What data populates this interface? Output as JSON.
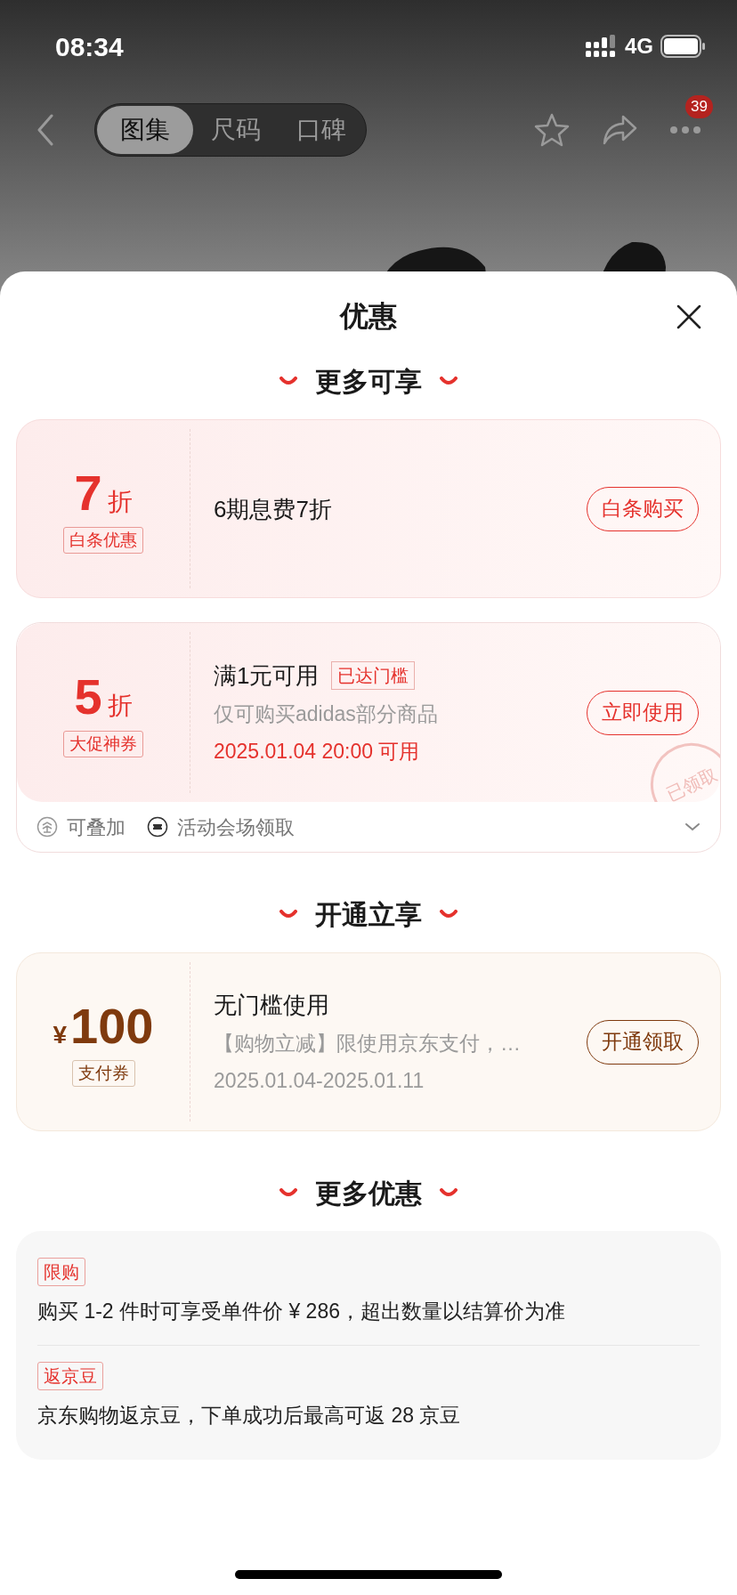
{
  "status_bar": {
    "time": "08:34",
    "network": "4G"
  },
  "nav": {
    "tabs": [
      {
        "label": "图集",
        "selected": true
      },
      {
        "label": "尺码",
        "selected": false
      },
      {
        "label": "口碑",
        "selected": false
      }
    ],
    "badge": "39"
  },
  "sheet": {
    "title": "优惠"
  },
  "sections": [
    {
      "title": "更多可享",
      "kind": "coupons",
      "coupons": [
        {
          "kind": "discount",
          "value": "7",
          "unit": "折",
          "tag": "白条优惠",
          "title": "6期息费7折",
          "button": "白条购买"
        },
        {
          "kind": "discount",
          "value": "5",
          "unit": "折",
          "tag": "大促神券",
          "title": "满1元可用",
          "badge": "已达门槛",
          "lines": [
            {
              "kind": "muted",
              "text": "仅可购买adidas部分商品"
            },
            {
              "kind": "accent",
              "text": "2025.01.04 20:00 可用"
            }
          ],
          "button": "立即使用",
          "stamp": "已领取",
          "footer": [
            {
              "kind": "stack",
              "text": "可叠加"
            },
            {
              "kind": "venue",
              "text": "活动会场领取"
            }
          ]
        }
      ]
    },
    {
      "title": "开通立享",
      "kind": "coupons",
      "coupons": [
        {
          "kind": "payment",
          "currency": "¥",
          "value": "100",
          "tag": "支付券",
          "title": "无门槛使用",
          "lines": [
            {
              "kind": "muted",
              "text": "【购物立减】限使用京东支付，…"
            },
            {
              "kind": "muted",
              "text": "2025.01.04-2025.01.11"
            }
          ],
          "button": "开通领取"
        }
      ]
    },
    {
      "title": "更多优惠",
      "kind": "list",
      "items": [
        {
          "tag": "限购",
          "text": "购买 1-2 件时可享受单件价 ¥ 286，超出数量以结算价为准"
        },
        {
          "tag": "返京豆",
          "text": "京东购物返京豆，下单成功后最高可返 28 京豆"
        }
      ]
    }
  ]
}
